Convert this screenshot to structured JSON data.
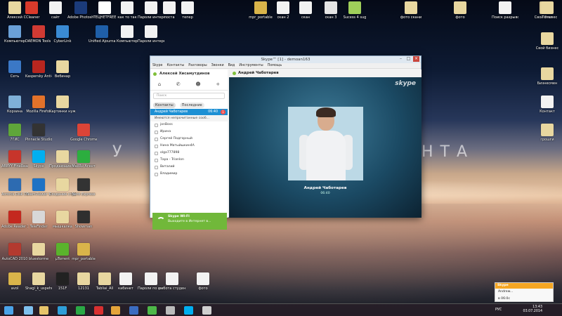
{
  "desktop": {
    "title_left": "У",
    "title_right": "НТА",
    "icons": [
      {
        "name": "Алексей",
        "color": "#e8d7a0"
      },
      {
        "name": "CCleaner",
        "color": "#d93a2b"
      },
      {
        "name": "сайт",
        "color": "#f2f2f2"
      },
      {
        "name": "Adobe Photosho...",
        "color": "#1b3b7a"
      },
      {
        "name": "ТЕЦНЕТFREE",
        "color": "#ffffff"
      },
      {
        "name": "как то так",
        "color": "#f2f2f2"
      },
      {
        "name": "Пароли интернет",
        "color": "#f2f2f2"
      },
      {
        "name": "поста",
        "color": "#f2f2f2"
      },
      {
        "name": "тепер",
        "color": "#f2f2f2"
      },
      {
        "name": "mpr_portable",
        "color": "#d9b44a"
      },
      {
        "name": "скан 2",
        "color": "#f2f2f2"
      },
      {
        "name": "скан",
        "color": "#f2f2f2"
      },
      {
        "name": "скан 3",
        "color": "#e5e5e5"
      },
      {
        "name": "Sucess 4 sug",
        "color": "#9fcf5a"
      },
      {
        "name": "фото скани",
        "color": "#e8d7a0"
      },
      {
        "name": "фото",
        "color": "#e8d7a0"
      },
      {
        "name": "Поиск разрывов",
        "color": "#f2f2f2"
      },
      {
        "name": "Свой бизнес",
        "color": "#e8d7a0"
      },
      {
        "name": "Компьютер",
        "color": "#6aa0d8"
      },
      {
        "name": "DAEMON Tools Lite",
        "color": "#d03a33"
      },
      {
        "name": "CyberLink",
        "color": "#3a8ad3"
      },
      {
        "name": "Unified Ajournal",
        "color": "#1f5fa8"
      },
      {
        "name": "Компьютер",
        "color": "#f2f2f2"
      },
      {
        "name": "Пароли интернет",
        "color": "#f2f2f2"
      },
      {
        "name": "Сеть",
        "color": "#3b78c6"
      },
      {
        "name": "Kaspersky Anti-Virus",
        "color": "#b8261f"
      },
      {
        "name": "Вебинар",
        "color": "#e8d7a0"
      },
      {
        "name": "Корзина",
        "color": "#7fb0d8"
      },
      {
        "name": "Mozilla Firefox",
        "color": "#e3722a"
      },
      {
        "name": "Картинки нужные",
        "color": "#e8d7a0"
      },
      {
        "name": "7ГИС",
        "color": "#5fa63a"
      },
      {
        "name": "Pinnacle Studio 16",
        "color": "#333333"
      },
      {
        "name": "Google Chrome",
        "color": "#db4437"
      },
      {
        "name": "ABBYY FineReader",
        "color": "#c7352b"
      },
      {
        "name": "Skype",
        "color": "#00aff0"
      },
      {
        "name": "Продающие страницы",
        "color": "#e8d7a0"
      },
      {
        "name": "MailRu Агент",
        "color": "#2cae3f"
      },
      {
        "name": "Acronis Disk Director",
        "color": "#2d6bb1"
      },
      {
        "name": "TeamViewer 9",
        "color": "#1e72c4"
      },
      {
        "name": "Создание страницы",
        "color": "#e8d7a0"
      },
      {
        "name": "Nero Express",
        "color": "#333333"
      },
      {
        "name": "Adobe Reader X",
        "color": "#c4281f"
      },
      {
        "name": "TeleFinder",
        "color": "#d8d8d8"
      },
      {
        "name": "мышкалка",
        "color": "#e8d7a0"
      },
      {
        "name": "Showman",
        "color": "#2f2f2f"
      },
      {
        "name": "AutoCAD 2010",
        "color": "#b33a2f"
      },
      {
        "name": "bluestorme",
        "color": "#e8d7a0"
      },
      {
        "name": "µTorrent",
        "color": "#5ab32c"
      },
      {
        "name": "mpr_portable",
        "color": "#d9b44a"
      },
      {
        "name": "avol",
        "color": "#d9b44a"
      },
      {
        "name": "Shagi_k_uspehu",
        "color": "#e8d7a0"
      },
      {
        "name": "151F",
        "color": "#222222"
      },
      {
        "name": "12131",
        "color": "#e8d7a0"
      },
      {
        "name": "Tabliai_All",
        "color": "#e8d7a0"
      },
      {
        "name": "кабинет",
        "color": "#f2f2f2"
      },
      {
        "name": "Пароли по интернет",
        "color": "#f2f2f2"
      },
      {
        "name": "работа студентам",
        "color": "#f2f2f2"
      },
      {
        "name": "фото",
        "color": "#f2f2f2"
      },
      {
        "name": "Бизнесмен",
        "color": "#e8d7a0"
      },
      {
        "name": "Контакт",
        "color": "#f2f2f2"
      },
      {
        "name": "грошги",
        "color": "#e8d7a0"
      },
      {
        "name": "Тотал",
        "color": "#e8d7a0"
      },
      {
        "name": "Свой бизнес",
        "color": "#e8d7a0"
      }
    ]
  },
  "skype": {
    "window_title": "Skype™ [1] - demoan163",
    "menu": [
      "Skype",
      "Контакты",
      "Разговоры",
      "Звонки",
      "Вид",
      "Инструменты",
      "Помощь"
    ],
    "user_name": "Алексей Хисамутдинов",
    "search_placeholder": "Поиск",
    "tabs": {
      "contacts": "Контакты",
      "recent": "Последние"
    },
    "selected_contact": {
      "name": "Андрей Чаботарев",
      "time": "06:40",
      "badge": "1"
    },
    "group_label": "Имеются непрочитанные сооб...",
    "contacts": [
      "jonBoss",
      "Ирина",
      "Сергей Подгорный",
      "Нина Матыйшкин4А",
      "olga777898",
      "Тара - Trianlon",
      "Виталий",
      "Владимир"
    ],
    "wifi": {
      "title": "Skype WI-FI",
      "text": "Выходите в Интернет в..."
    },
    "chat_header": "Андрей Чаботарев",
    "logo": "skype",
    "caller_name": "Андрей Чаботарев",
    "call_time": "06:40"
  },
  "taskbar": {
    "lang": "РУС",
    "time": "13:43",
    "date": "03.07.2014"
  },
  "notification": {
    "header": "Skype",
    "line1": "Andrew...",
    "line2": "в 06:0с"
  }
}
